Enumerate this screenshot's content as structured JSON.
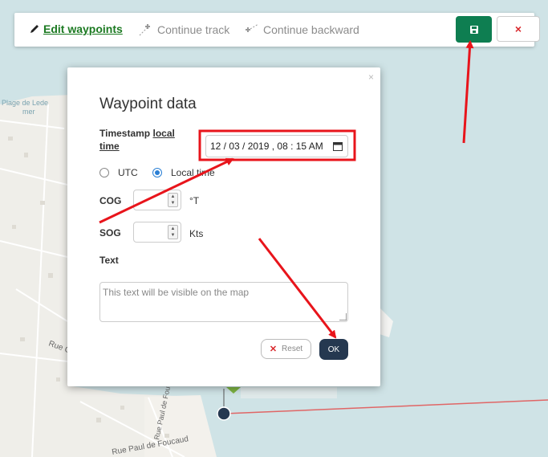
{
  "map": {
    "labels": {
      "place": "Plage de Lede\nmer",
      "street_1": "Rue C",
      "street_2": "Rue Paul de Foucaud",
      "street_3": "Rue Paul de Foucaud"
    }
  },
  "toolbar": {
    "edit_label": "Edit waypoints",
    "continue_label": "Continue track",
    "backward_label": "Continue backward",
    "close_label": "×"
  },
  "dialog": {
    "close_label": "×",
    "title": "Waypoint data",
    "timestamp_label": "Timestamp",
    "timestamp_link": "local",
    "timestamp_link2": "time",
    "datetime_value": "12 / 03 / 2019 ,  08 : 15   AM",
    "utc_label": "UTC",
    "local_label": "Local time",
    "utc_selected": false,
    "cog_label": "COG",
    "cog_value": "",
    "cog_unit": "°T",
    "sog_label": "SOG",
    "sog_value": "",
    "sog_unit": "Kts",
    "text_label": "Text",
    "text_placeholder": "This text will be visible on the map",
    "reset_label": "Reset",
    "ok_label": "OK"
  },
  "colors": {
    "sea": "#cfe3e6",
    "land": "#efeee9",
    "edit_green": "#1c7a22",
    "save_green": "#0e7e51",
    "ok_navy": "#253850",
    "arrow_red": "#e8141b",
    "track_red": "#e06666"
  }
}
